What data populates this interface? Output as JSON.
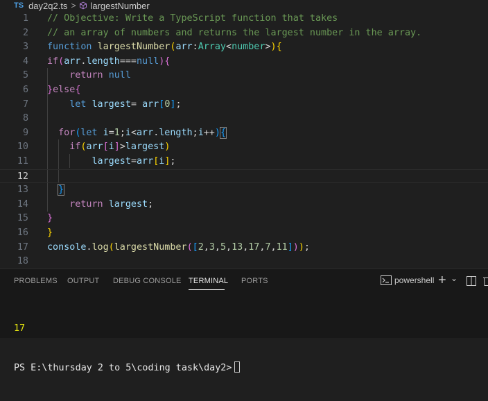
{
  "breadcrumb": {
    "lang_badge": "TS",
    "file": "day2q2.ts",
    "separator": ">",
    "symbol": "largestNumber"
  },
  "editor": {
    "line_numbers": [
      "1",
      "2",
      "3",
      "4",
      "5",
      "6",
      "7",
      "8",
      "9",
      "10",
      "11",
      "12",
      "13",
      "14",
      "15",
      "16",
      "17",
      "18"
    ],
    "current_line": 12,
    "lines": [
      [
        [
          "c-comment",
          "// Objective: Write a TypeScript function that takes"
        ]
      ],
      [
        [
          "c-comment",
          "// an array of numbers and returns the largest number in the array."
        ]
      ],
      [
        [
          "c-kw",
          "function "
        ],
        [
          "c-fn",
          "largestNumber"
        ],
        [
          "c-br1",
          "("
        ],
        [
          "c-var",
          "arr"
        ],
        [
          "c-pun",
          ":"
        ],
        [
          "c-type",
          "Array"
        ],
        [
          "c-pun",
          "<"
        ],
        [
          "c-type",
          "number"
        ],
        [
          "c-pun",
          ">"
        ],
        [
          "c-br1",
          ")"
        ],
        [
          "c-br1",
          "{"
        ]
      ],
      [
        [
          "c-ctrl",
          "if"
        ],
        [
          "c-br2",
          "("
        ],
        [
          "c-var",
          "arr"
        ],
        [
          "c-pun",
          "."
        ],
        [
          "c-var",
          "length"
        ],
        [
          "c-pun",
          "==="
        ],
        [
          "c-kw",
          "null"
        ],
        [
          "c-br2",
          ")"
        ],
        [
          "c-br2",
          "{"
        ]
      ],
      [
        [
          "c-def",
          "    "
        ],
        [
          "c-ctrl",
          "return "
        ],
        [
          "c-kw",
          "null"
        ]
      ],
      [
        [
          "c-br2",
          "}"
        ],
        [
          "c-ctrl",
          "else"
        ],
        [
          "c-br2",
          "{"
        ]
      ],
      [
        [
          "c-def",
          "    "
        ],
        [
          "c-kw",
          "let "
        ],
        [
          "c-var",
          "largest"
        ],
        [
          "c-pun",
          "= "
        ],
        [
          "c-var",
          "arr"
        ],
        [
          "c-br3",
          "["
        ],
        [
          "c-num",
          "0"
        ],
        [
          "c-br3",
          "]"
        ],
        [
          "c-pun",
          ";"
        ]
      ],
      [],
      [
        [
          "c-def",
          "  "
        ],
        [
          "c-ctrl",
          "for"
        ],
        [
          "c-br3",
          "("
        ],
        [
          "c-kw",
          "let "
        ],
        [
          "c-var",
          "i"
        ],
        [
          "c-pun",
          "="
        ],
        [
          "c-num",
          "1"
        ],
        [
          "c-pun",
          ";"
        ],
        [
          "c-var",
          "i"
        ],
        [
          "c-pun",
          "<"
        ],
        [
          "c-var",
          "arr"
        ],
        [
          "c-pun",
          "."
        ],
        [
          "c-var",
          "length"
        ],
        [
          "c-pun",
          ";"
        ],
        [
          "c-var",
          "i"
        ],
        [
          "c-pun",
          "++"
        ],
        [
          "c-br3",
          ")"
        ],
        [
          "c-br3 bracket-box",
          "{"
        ]
      ],
      [
        [
          "c-def",
          "    "
        ],
        [
          "c-ctrl",
          "if"
        ],
        [
          "c-br1",
          "("
        ],
        [
          "c-var",
          "arr"
        ],
        [
          "c-br2",
          "["
        ],
        [
          "c-var",
          "i"
        ],
        [
          "c-br2",
          "]"
        ],
        [
          "c-pun",
          ">"
        ],
        [
          "c-var",
          "largest"
        ],
        [
          "c-br1",
          ")"
        ]
      ],
      [
        [
          "c-def",
          "        "
        ],
        [
          "c-var",
          "largest"
        ],
        [
          "c-pun",
          "="
        ],
        [
          "c-var",
          "arr"
        ],
        [
          "c-br1",
          "["
        ],
        [
          "c-var",
          "i"
        ],
        [
          "c-br1",
          "]"
        ],
        [
          "c-pun",
          ";"
        ]
      ],
      [],
      [
        [
          "c-def",
          "  "
        ],
        [
          "c-br3 bracket-box",
          "}"
        ]
      ],
      [
        [
          "c-def",
          "    "
        ],
        [
          "c-ctrl",
          "return "
        ],
        [
          "c-var",
          "largest"
        ],
        [
          "c-pun",
          ";"
        ]
      ],
      [
        [
          "c-br2",
          "}"
        ]
      ],
      [
        [
          "c-br1",
          "}"
        ]
      ],
      [
        [
          "c-var",
          "console"
        ],
        [
          "c-pun",
          "."
        ],
        [
          "c-fn",
          "log"
        ],
        [
          "c-br1",
          "("
        ],
        [
          "c-fn",
          "largestNumber"
        ],
        [
          "c-br2",
          "("
        ],
        [
          "c-br3",
          "["
        ],
        [
          "c-num",
          "2"
        ],
        [
          "c-pun",
          ","
        ],
        [
          "c-num",
          "3"
        ],
        [
          "c-pun",
          ","
        ],
        [
          "c-num",
          "5"
        ],
        [
          "c-pun",
          ","
        ],
        [
          "c-num",
          "13"
        ],
        [
          "c-pun",
          ","
        ],
        [
          "c-num",
          "17"
        ],
        [
          "c-pun",
          ","
        ],
        [
          "c-num",
          "7"
        ],
        [
          "c-pun",
          ","
        ],
        [
          "c-num",
          "11"
        ],
        [
          "c-br3",
          "]"
        ],
        [
          "c-br2",
          ")"
        ],
        [
          "c-br1",
          ")"
        ],
        [
          "c-pun",
          ";"
        ]
      ],
      []
    ]
  },
  "panel": {
    "tabs": [
      "PROBLEMS",
      "OUTPUT",
      "DEBUG CONSOLE",
      "TERMINAL",
      "PORTS"
    ],
    "active_tab": "TERMINAL",
    "shell_label": "powershell",
    "new_terminal": "+",
    "dropdown": "⌄",
    "terminal": {
      "output": "17",
      "prompt": "PS E:\\thursday 2 to 5\\coding task\\day2>"
    }
  }
}
